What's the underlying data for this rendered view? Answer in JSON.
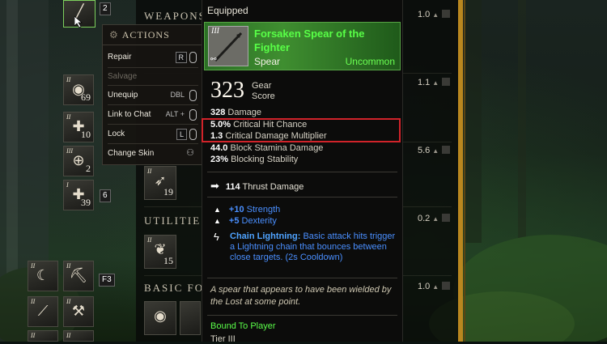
{
  "colors": {
    "uncommon_green": "#58ff47",
    "stat_blue": "#4a8fff",
    "highlight_red": "#d1232a",
    "accent_gold": "#b9871f"
  },
  "inventory": {
    "sections": {
      "weapons": "WEAPONS",
      "utilities": "UTILITIES",
      "basic_food": "BASIC FOO"
    },
    "weights": [
      "1.0",
      "1.1",
      "5.6",
      "0.2",
      "1.0"
    ],
    "equipped_slot_badge": "2",
    "badge_6": "6",
    "badge_f3": "F3",
    "left_slots": [
      {
        "tier": "II",
        "qty": "69",
        "icon": "food-bowl-icon"
      },
      {
        "tier": "II",
        "qty": "10",
        "icon": "health-cross-icon"
      },
      {
        "tier": "III",
        "qty": "2",
        "icon": "potion-icon"
      },
      {
        "tier": "I",
        "qty": "39",
        "icon": "health-cross-icon"
      }
    ],
    "mid_slots": [
      {
        "tier": "II",
        "qty": "19",
        "icon": "arrow-icon"
      },
      {
        "tier": "II",
        "qty": "15",
        "icon": "herb-icon"
      }
    ],
    "bottom_tiers": [
      "II",
      "II",
      "II",
      "II",
      "II",
      "II"
    ]
  },
  "actions_menu": {
    "title": "ACTIONS",
    "items": [
      {
        "label": "Repair",
        "key": "R",
        "mouse": true,
        "enabled": true
      },
      {
        "label": "Salvage",
        "key": "",
        "mouse": false,
        "enabled": false
      },
      {
        "label": "Unequip",
        "key": "DBL",
        "mouse": true,
        "enabled": true
      },
      {
        "label": "Link to Chat",
        "key": "ALT +",
        "mouse": true,
        "enabled": true
      },
      {
        "label": "Lock",
        "key": "L",
        "mouse": true,
        "enabled": true
      },
      {
        "label": "Change Skin",
        "key": "",
        "mouse": false,
        "enabled": true
      }
    ]
  },
  "tooltip": {
    "equipped_label": "Equipped",
    "icon_tier": "III",
    "item_name": "Forsaken Spear of the Fighter",
    "item_type": "Spear",
    "rarity": "Uncommon",
    "gear_score": "323",
    "gear_score_label_1": "Gear",
    "gear_score_label_2": "Score",
    "stats": [
      {
        "value": "328",
        "label": "Damage",
        "highlighted": false
      },
      {
        "value": "5.0%",
        "label": "Critical Hit Chance",
        "highlighted": true
      },
      {
        "value": "1.3",
        "label": "Critical Damage Multiplier",
        "highlighted": true
      },
      {
        "value": "44.0",
        "label": "Block Stamina Damage",
        "highlighted": false
      },
      {
        "value": "23%",
        "label": "Blocking Stability",
        "highlighted": false
      }
    ],
    "thrust": {
      "value": "114",
      "label": "Thrust Damage"
    },
    "attributes": [
      {
        "value": "+10",
        "label": "Strength"
      },
      {
        "value": "+5",
        "label": "Dexterity"
      }
    ],
    "perk": {
      "name": "Chain Lightning:",
      "description": "Basic attack hits trigger a Lightning chain that bounces between close targets. (2s Cooldown)"
    },
    "lore": "A spear that appears to have been wielded by the Lost at some point.",
    "bound": "Bound To Player",
    "tier_text": "Tier III"
  }
}
